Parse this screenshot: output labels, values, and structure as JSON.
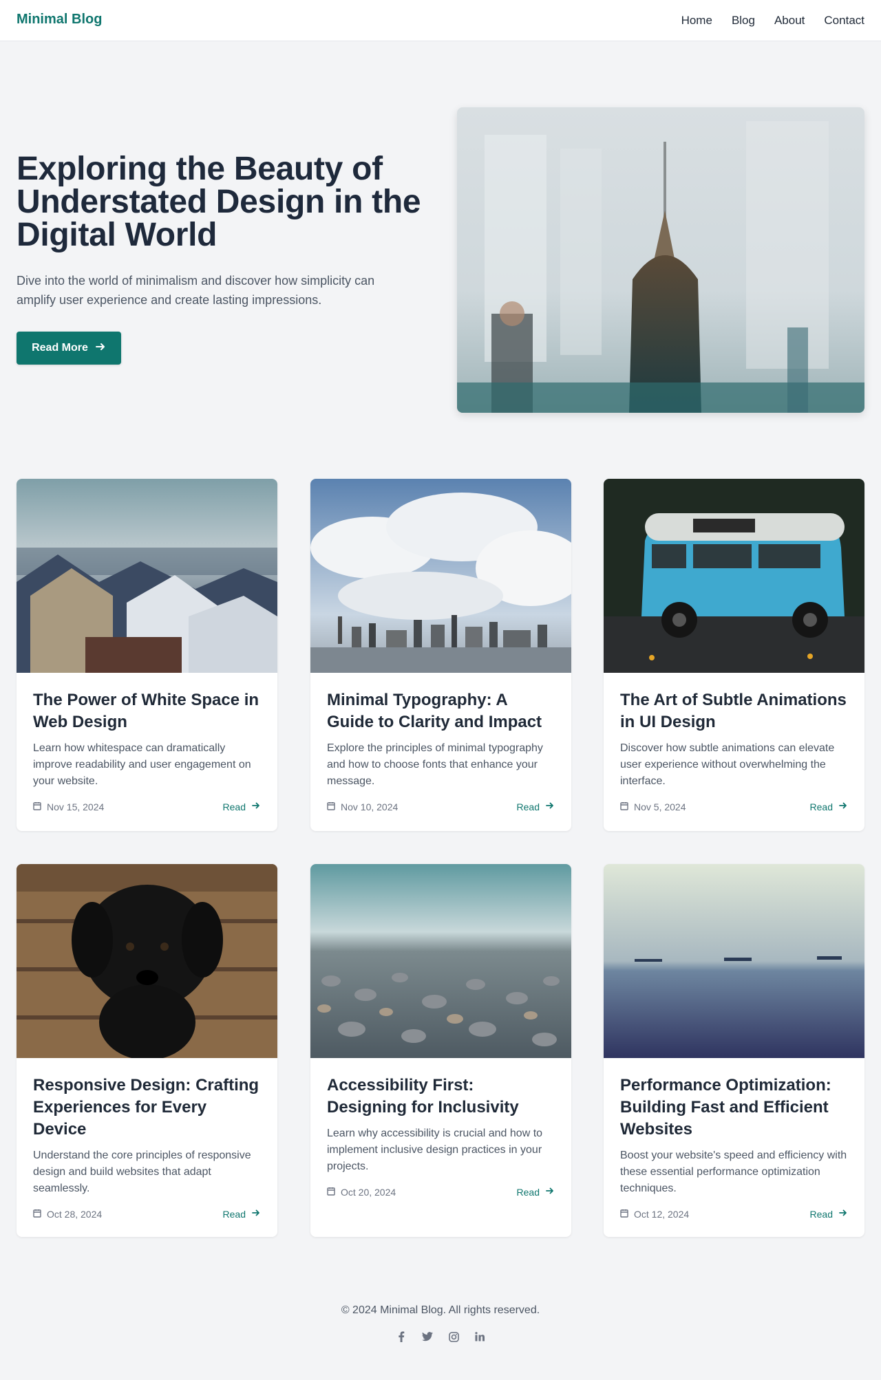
{
  "header": {
    "brand": "Minimal Blog",
    "nav": [
      "Home",
      "Blog",
      "About",
      "Contact"
    ]
  },
  "hero": {
    "title": "Exploring the Beauty of Understated Design in the Digital World",
    "subtitle": "Dive into the world of minimalism and discover how simplicity can amplify user experience and create lasting impressions.",
    "button": "Read More",
    "button_icon": "arrow-right-icon",
    "image_icon": "city-double-exposure-photo"
  },
  "posts": [
    {
      "title": "The Power of White Space in Web Design",
      "excerpt": "Learn how whitespace can dramatically improve readability and user engagement on your website.",
      "date": "Nov 15, 2024",
      "read": "Read",
      "image": "snowy-rooftops-photo"
    },
    {
      "title": "Minimal Typography: A Guide to Clarity and Impact",
      "excerpt": "Explore the principles of minimal typography and how to choose fonts that enhance your message.",
      "date": "Nov 10, 2024",
      "read": "Read",
      "image": "city-skyline-clouds-photo"
    },
    {
      "title": "The Art of Subtle Animations in UI Design",
      "excerpt": "Discover how subtle animations can elevate user experience without overwhelming the interface.",
      "date": "Nov 5, 2024",
      "read": "Read",
      "image": "blue-van-photo"
    },
    {
      "title": "Responsive Design: Crafting Experiences for Every Device",
      "excerpt": "Understand the core principles of responsive design and build websites that adapt seamlessly.",
      "date": "Oct 28, 2024",
      "read": "Read",
      "image": "black-puppy-photo"
    },
    {
      "title": "Accessibility First: Designing for Inclusivity",
      "excerpt": "Learn why accessibility is crucial and how to implement inclusive design practices in your projects.",
      "date": "Oct 20, 2024",
      "read": "Read",
      "image": "pebble-beach-photo"
    },
    {
      "title": "Performance Optimization: Building Fast and Efficient Websites",
      "excerpt": "Boost your website's speed and efficiency with these essential performance optimization techniques.",
      "date": "Oct 12, 2024",
      "read": "Read",
      "image": "sea-ships-photo"
    }
  ],
  "footer": {
    "copyright": "© 2024 Minimal Blog. All rights reserved.",
    "social": [
      "facebook-icon",
      "twitter-icon",
      "instagram-icon",
      "linkedin-icon"
    ]
  },
  "colors": {
    "accent": "#0f766e",
    "background": "#f3f4f6",
    "text": "#1f2937"
  }
}
